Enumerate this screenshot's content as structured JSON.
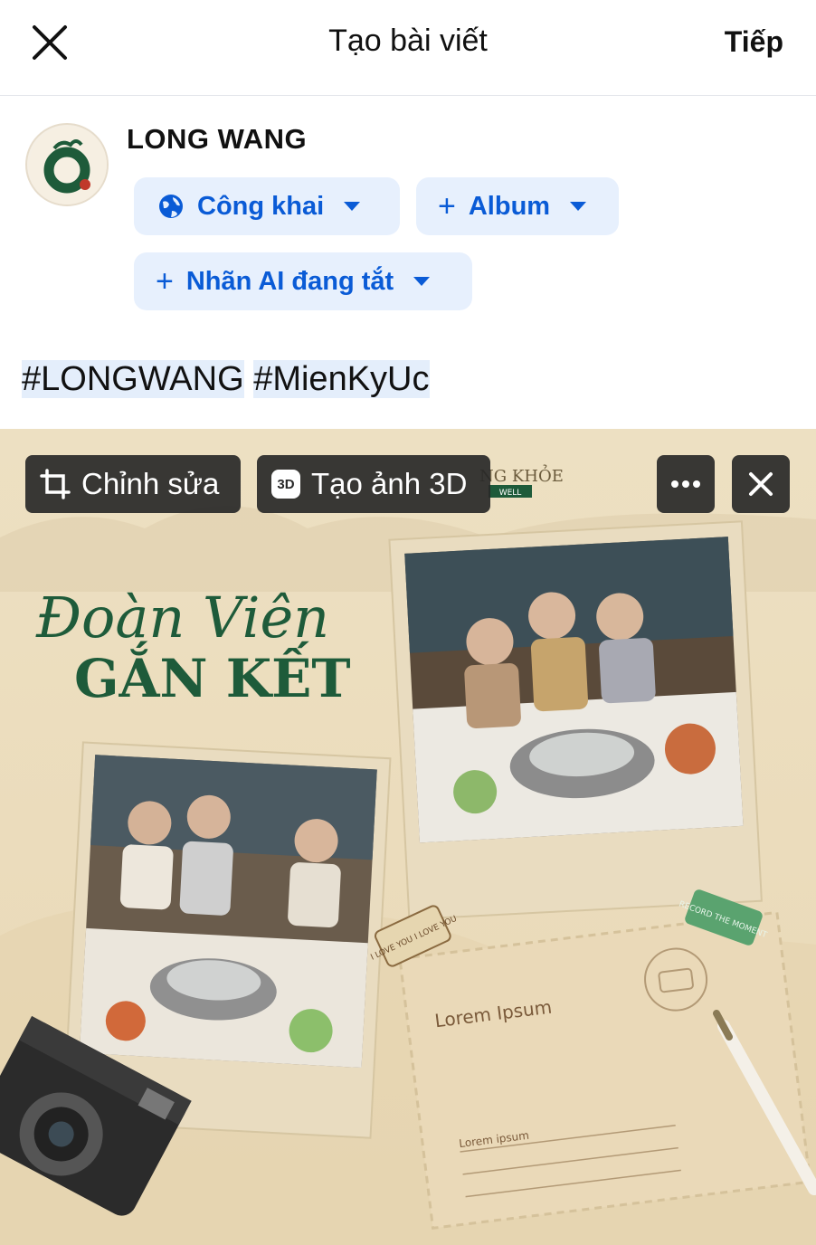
{
  "header": {
    "title": "Tạo bài viết",
    "next_label": "Tiếp"
  },
  "profile": {
    "name": "LONG WANG"
  },
  "chips": {
    "audience": "Công khai",
    "album": "Album",
    "ai_label": "Nhãn AI đang tắt"
  },
  "caption": {
    "tags": [
      "#LONGWANG",
      "#MienKyUc"
    ]
  },
  "photo_toolbar": {
    "edit_label": "Chỉnh sửa",
    "make3d_label": "Tạo ảnh 3D",
    "badge_3d": "3D"
  },
  "poster": {
    "script_line": "Đoàn Viên",
    "title": "GẮN KẾT",
    "brand_fragment": "NG KHỎE",
    "brand_tag": "WELL",
    "sticker_love": "I LOVE YOU I LOVE YOU",
    "sticker_record": "RECORD THE MOMENT",
    "postcard_title": "Lorem Ipsum",
    "postcard_small": "Lorem ipsum"
  },
  "colors": {
    "accent_blue": "#0a5bd6",
    "chip_bg": "#e7f0fd",
    "brand_green": "#1e5b3a",
    "overlay_dark": "#282828"
  }
}
